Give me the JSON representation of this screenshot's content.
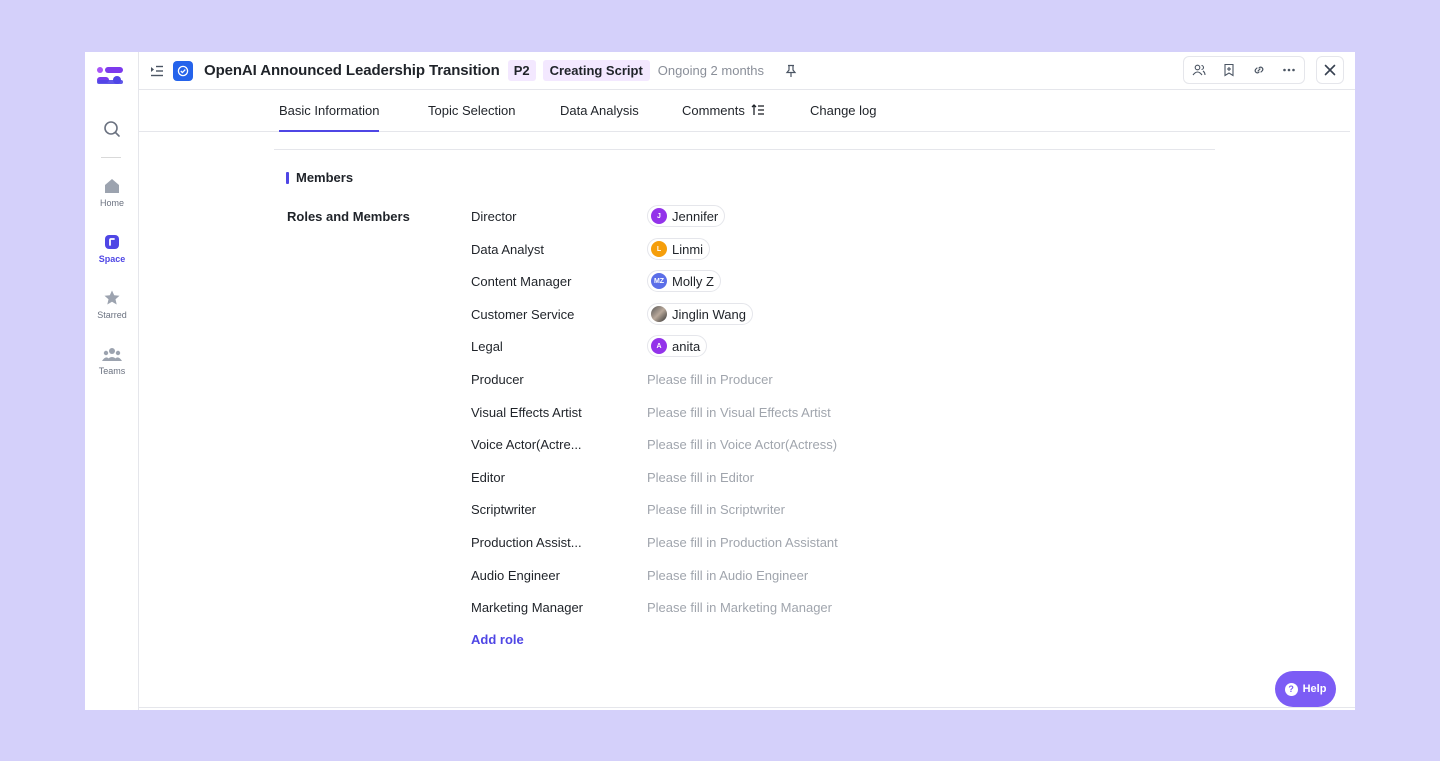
{
  "sidebar": {
    "items": [
      {
        "label": "Home",
        "icon": "home-icon"
      },
      {
        "label": "Space",
        "icon": "space-icon"
      },
      {
        "label": "Starred",
        "icon": "star-icon"
      },
      {
        "label": "Teams",
        "icon": "teams-icon"
      }
    ]
  },
  "header": {
    "title": "OpenAI Announced Leadership Transition",
    "priority": "P2",
    "status": "Creating Script",
    "duration": "Ongoing 2 months"
  },
  "tabs": [
    "Basic Information",
    "Topic Selection",
    "Data Analysis",
    "Comments",
    "Change log"
  ],
  "section": {
    "title": "Members",
    "roles_label": "Roles and Members",
    "add_role": "Add role"
  },
  "roles": [
    {
      "role": "Director",
      "member": "Jennifer",
      "initials": "J"
    },
    {
      "role": "Data Analyst",
      "member": "Linmi",
      "initials": "L"
    },
    {
      "role": "Content Manager",
      "member": "Molly Z",
      "initials": "MZ"
    },
    {
      "role": "Customer Service",
      "member": "Jinglin Wang",
      "initials": ""
    },
    {
      "role": "Legal",
      "member": "anita",
      "initials": "A"
    },
    {
      "role": "Producer",
      "placeholder": "Please fill in Producer"
    },
    {
      "role": "Visual Effects Artist",
      "placeholder": "Please fill in Visual Effects Artist"
    },
    {
      "role": "Voice Actor(Actre...",
      "placeholder": "Please fill in Voice Actor(Actress)"
    },
    {
      "role": "Editor",
      "placeholder": "Please fill in Editor"
    },
    {
      "role": "Scriptwriter",
      "placeholder": "Please fill in Scriptwriter"
    },
    {
      "role": "Production Assist...",
      "placeholder": "Please fill in Production Assistant"
    },
    {
      "role": "Audio Engineer",
      "placeholder": "Please fill in Audio Engineer"
    },
    {
      "role": "Marketing Manager",
      "placeholder": "Please fill in Marketing Manager"
    }
  ],
  "help": {
    "label": "Help"
  },
  "colors": {
    "accent": "#4f46e5",
    "background": "#d4d0fa",
    "badge_bg": "#f3e8ff",
    "help_bg": "#7c5cf5",
    "placeholder": "#a0a5ad",
    "task_icon": "#2563eb"
  }
}
